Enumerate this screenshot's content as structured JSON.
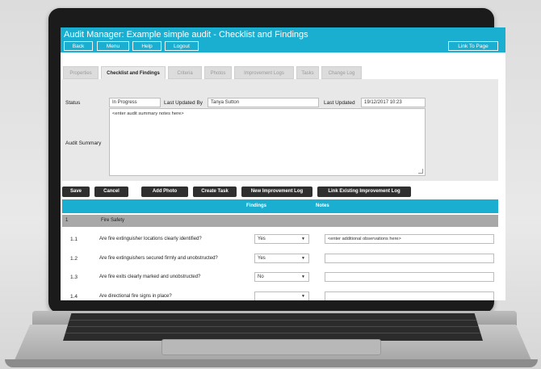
{
  "app": {
    "title": "Audit Manager: Example simple audit - Checklist and Findings"
  },
  "toolbar": {
    "back": "Back",
    "menu": "Menu",
    "help": "Help",
    "logout": "Logout",
    "link_to_page": "Link To Page"
  },
  "tabs": [
    {
      "label": "Properties",
      "active": false
    },
    {
      "label": "Checklist and Findings",
      "active": true
    },
    {
      "label": "Criteria",
      "active": false
    },
    {
      "label": "Photos",
      "active": false
    },
    {
      "label": "Improvement Logs",
      "active": false
    },
    {
      "label": "Tasks",
      "active": false
    },
    {
      "label": "Change Log",
      "active": false
    }
  ],
  "form": {
    "status_label": "Status",
    "status_value": "In Progress",
    "updated_by_label": "Last Updated By",
    "updated_by_value": "Tanya Sutton",
    "last_updated_label": "Last Updated",
    "last_updated_value": "19/12/2017 10:23",
    "summary_label": "Audit Summary",
    "summary_value": "<enter audit summary notes here>"
  },
  "actions": {
    "save": "Save",
    "cancel": "Cancel",
    "add_photo": "Add Photo",
    "create_task": "Create Task",
    "new_improvement_log": "New Improvement Log",
    "link_existing": "Link Existing Improvement Log"
  },
  "table": {
    "headers": {
      "findings": "Findings",
      "notes": "Notes"
    },
    "section": {
      "num": "1",
      "title": "Fire Safety"
    },
    "rows": [
      {
        "num": "1.1",
        "question": "Are fire extinguisher locations clearly identified?",
        "finding": "Yes",
        "note": "<enter additional observations here>"
      },
      {
        "num": "1.2",
        "question": "Are fire extinguishers secured firmly and unobstructed?",
        "finding": "Yes",
        "note": ""
      },
      {
        "num": "1.3",
        "question": "Are fire exits clearly marked and unobstructed?",
        "finding": "No",
        "note": ""
      },
      {
        "num": "1.4",
        "question": "Are directional fire signs in place?",
        "finding": "",
        "note": ""
      }
    ]
  },
  "colors": {
    "accent": "#1aaed0",
    "section_bg": "#a8a8a8",
    "button_dark": "#2f2f2f"
  }
}
